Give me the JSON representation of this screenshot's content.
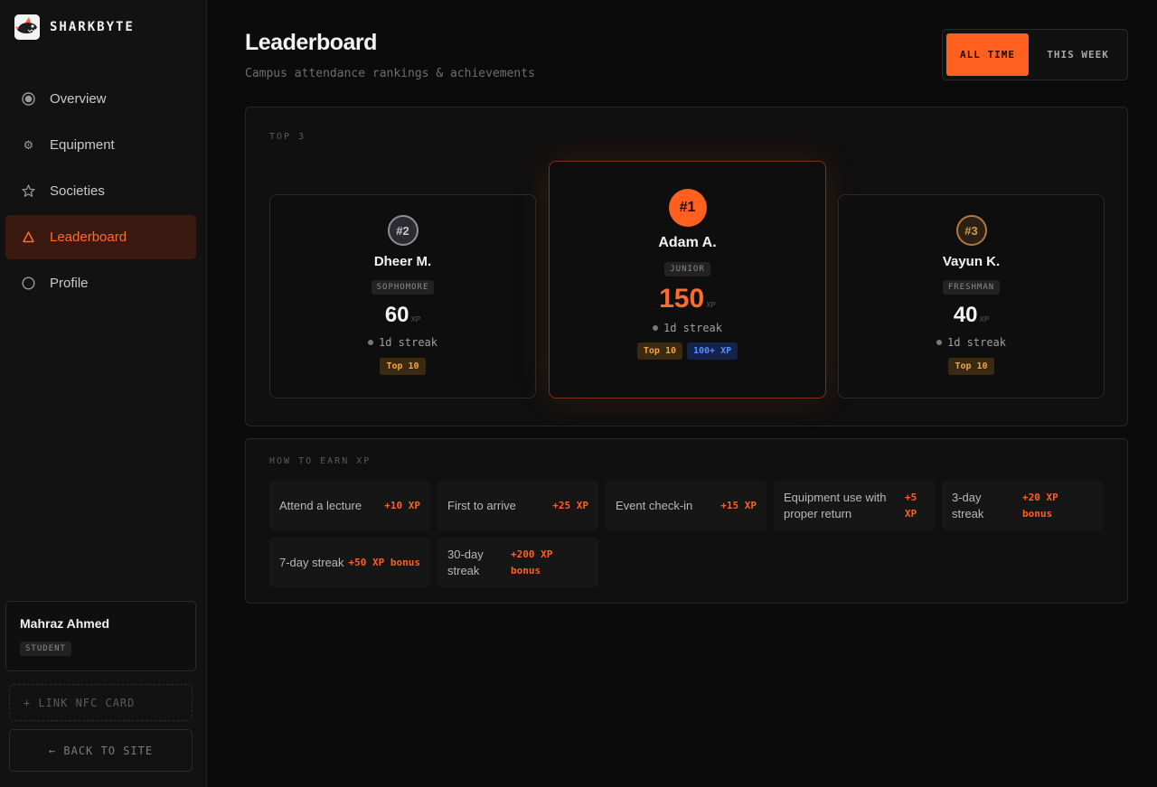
{
  "brand": {
    "name": "SHARKBYTE"
  },
  "nav": [
    {
      "label": "Overview",
      "icon": "radio-icon",
      "active": false
    },
    {
      "label": "Equipment",
      "icon": "gear-icon",
      "active": false
    },
    {
      "label": "Societies",
      "icon": "star-icon",
      "active": false
    },
    {
      "label": "Leaderboard",
      "icon": "triangle-icon",
      "active": true
    },
    {
      "label": "Profile",
      "icon": "circle-icon",
      "active": false
    }
  ],
  "user": {
    "name": "Mahraz Ahmed",
    "role": "STUDENT"
  },
  "actions": {
    "link_nfc": "+ LINK NFC CARD",
    "back": "← BACK TO SITE"
  },
  "header": {
    "title": "Leaderboard",
    "subtitle": "Campus attendance rankings & achievements"
  },
  "range_toggle": {
    "all_time": "ALL TIME",
    "this_week": "THIS WEEK",
    "selected": "ALL TIME"
  },
  "top3": {
    "label": "TOP 3",
    "players": [
      {
        "rank": "#2",
        "name": "Dheer M.",
        "year": "SOPHOMORE",
        "xp": "60",
        "xp_unit": "XP",
        "streak": "1d streak",
        "badges": [
          "Top 10"
        ]
      },
      {
        "rank": "#1",
        "name": "Adam A.",
        "year": "JUNIOR",
        "xp": "150",
        "xp_unit": "XP",
        "streak": "1d streak",
        "badges": [
          "Top 10",
          "100+ XP"
        ]
      },
      {
        "rank": "#3",
        "name": "Vayun K.",
        "year": "FRESHMAN",
        "xp": "40",
        "xp_unit": "XP",
        "streak": "1d streak",
        "badges": [
          "Top 10"
        ]
      }
    ]
  },
  "earn": {
    "label": "HOW TO EARN XP",
    "rows": [
      [
        {
          "label": "Attend a lecture",
          "value": "+10 XP"
        },
        {
          "label": "First to arrive",
          "value": "+25 XP"
        },
        {
          "label": "Event check-in",
          "value": "+15 XP"
        },
        {
          "label": "Equipment use with proper return",
          "value": "+5 XP"
        },
        {
          "label": "3-day streak",
          "value": "+20 XP bonus"
        }
      ],
      [
        {
          "label": "7-day streak",
          "value": "+50 XP bonus"
        },
        {
          "label": "30-day streak",
          "value": "+200 XP bonus"
        }
      ]
    ]
  },
  "colors": {
    "accent": "#ff5f1f",
    "background": "#0b0b0b",
    "gold_badge": "#f4a340",
    "blue_badge": "#5a8cff"
  }
}
